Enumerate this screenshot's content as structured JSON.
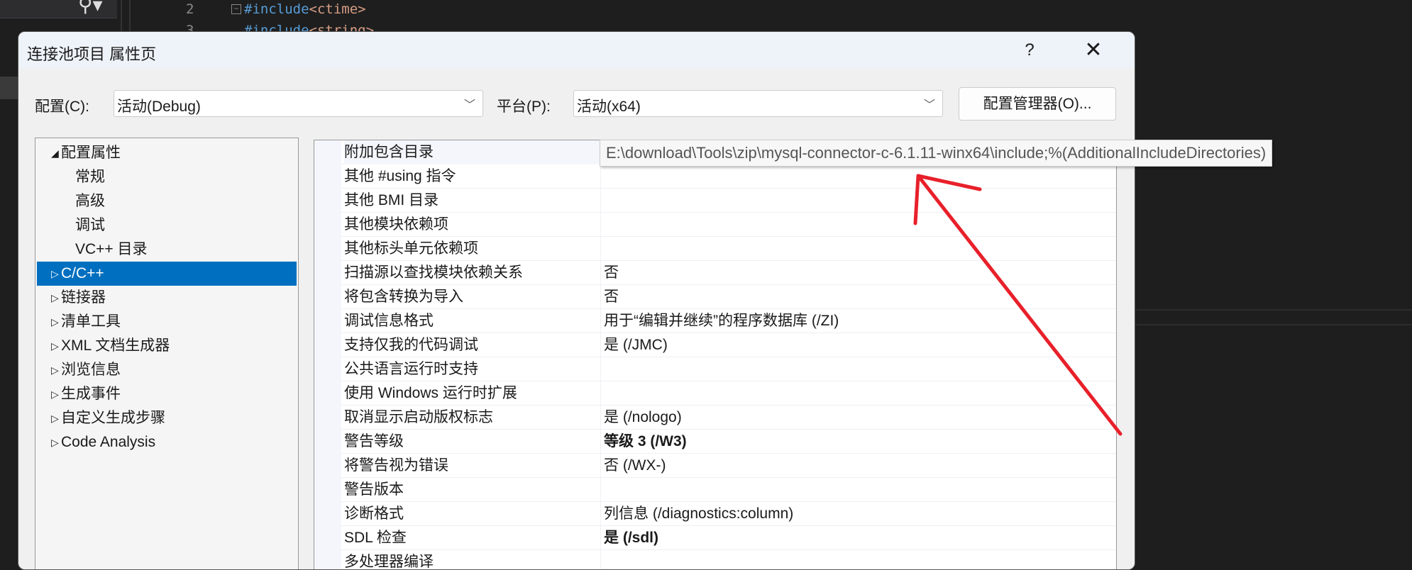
{
  "editor": {
    "line_numbers": [
      "2",
      "3"
    ],
    "code_lines": [
      {
        "kw": "#include",
        "arg": "<ctime>"
      },
      {
        "kw": "#include",
        "arg": "<string>"
      }
    ]
  },
  "dialog": {
    "title": "连接池项目 属性页",
    "help": "?",
    "close": "✕",
    "config_label": "配置(C):",
    "config_value": "活动(Debug)",
    "platform_label": "平台(P):",
    "platform_value": "活动(x64)",
    "config_manager": "配置管理器(O)..."
  },
  "tree": [
    {
      "label": "配置属性",
      "expander": "◢",
      "child": false
    },
    {
      "label": "常规",
      "expander": "",
      "child": true
    },
    {
      "label": "高级",
      "expander": "",
      "child": true
    },
    {
      "label": "调试",
      "expander": "",
      "child": true
    },
    {
      "label": "VC++ 目录",
      "expander": "",
      "child": true
    },
    {
      "label": "C/C++",
      "expander": "▷",
      "child": false,
      "selected": true
    },
    {
      "label": "链接器",
      "expander": "▷",
      "child": false
    },
    {
      "label": "清单工具",
      "expander": "▷",
      "child": false
    },
    {
      "label": "XML 文档生成器",
      "expander": "▷",
      "child": false
    },
    {
      "label": "浏览信息",
      "expander": "▷",
      "child": false
    },
    {
      "label": "生成事件",
      "expander": "▷",
      "child": false
    },
    {
      "label": "自定义生成步骤",
      "expander": "▷",
      "child": false
    },
    {
      "label": "Code Analysis",
      "expander": "▷",
      "child": false
    }
  ],
  "properties": [
    {
      "name": "附加包含目录",
      "value": ""
    },
    {
      "name": "其他 #using 指令",
      "value": ""
    },
    {
      "name": "其他 BMI 目录",
      "value": ""
    },
    {
      "name": "其他模块依赖项",
      "value": ""
    },
    {
      "name": "其他标头单元依赖项",
      "value": ""
    },
    {
      "name": "扫描源以查找模块依赖关系",
      "value": "否"
    },
    {
      "name": "将包含转换为导入",
      "value": "否"
    },
    {
      "name": "调试信息格式",
      "value": "用于“编辑并继续”的程序数据库 (/ZI)"
    },
    {
      "name": "支持仅我的代码调试",
      "value": "是 (/JMC)"
    },
    {
      "name": "公共语言运行时支持",
      "value": ""
    },
    {
      "name": "使用 Windows 运行时扩展",
      "value": ""
    },
    {
      "name": "取消显示启动版权标志",
      "value": "是 (/nologo)"
    },
    {
      "name": "警告等级",
      "value": "等级 3 (/W3)",
      "bold": true
    },
    {
      "name": "将警告视为错误",
      "value": "否 (/WX-)"
    },
    {
      "name": "警告版本",
      "value": ""
    },
    {
      "name": "诊断格式",
      "value": "列信息 (/diagnostics:column)"
    },
    {
      "name": "SDL 检查",
      "value": "是 (/sdl)",
      "bold": true
    },
    {
      "name": "多处理器编译",
      "value": ""
    }
  ],
  "tooltip": "E:\\download\\Tools\\zip\\mysql-connector-c-6.1.11-winx64\\include;%(AdditionalIncludeDirectories)",
  "colors": {
    "selection": "#006fc0",
    "annotation_arrow": "#e8202a",
    "editor_bg": "#1e1e1e"
  }
}
